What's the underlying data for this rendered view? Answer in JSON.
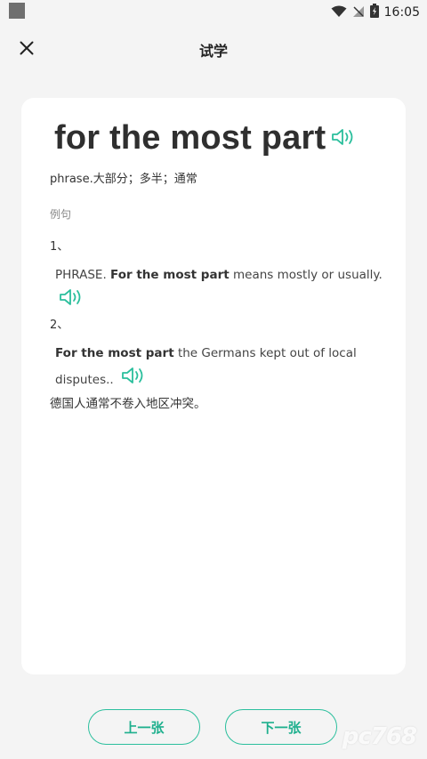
{
  "status_bar": {
    "time": "16:05"
  },
  "header": {
    "title": "试学",
    "close_icon": "close-icon"
  },
  "card": {
    "headword": "for the most part",
    "definition": "phrase.大部分；多半；通常",
    "examples_label": "例句",
    "examples": [
      {
        "number": "1、",
        "prefix": "PHRASE. ",
        "bold": "For the most part",
        "rest": " means mostly or usually.",
        "translation": ""
      },
      {
        "number": "2、",
        "prefix": "",
        "bold": "For the most part",
        "rest": " the Germans kept out of local disputes..",
        "translation": "德国人通常不卷入地区冲突。"
      }
    ]
  },
  "buttons": {
    "prev": "上一张",
    "next": "下一张"
  },
  "watermark": "pc768",
  "colors": {
    "accent": "#2bbf9d",
    "background": "#f4f4f4",
    "card": "#ffffff"
  }
}
